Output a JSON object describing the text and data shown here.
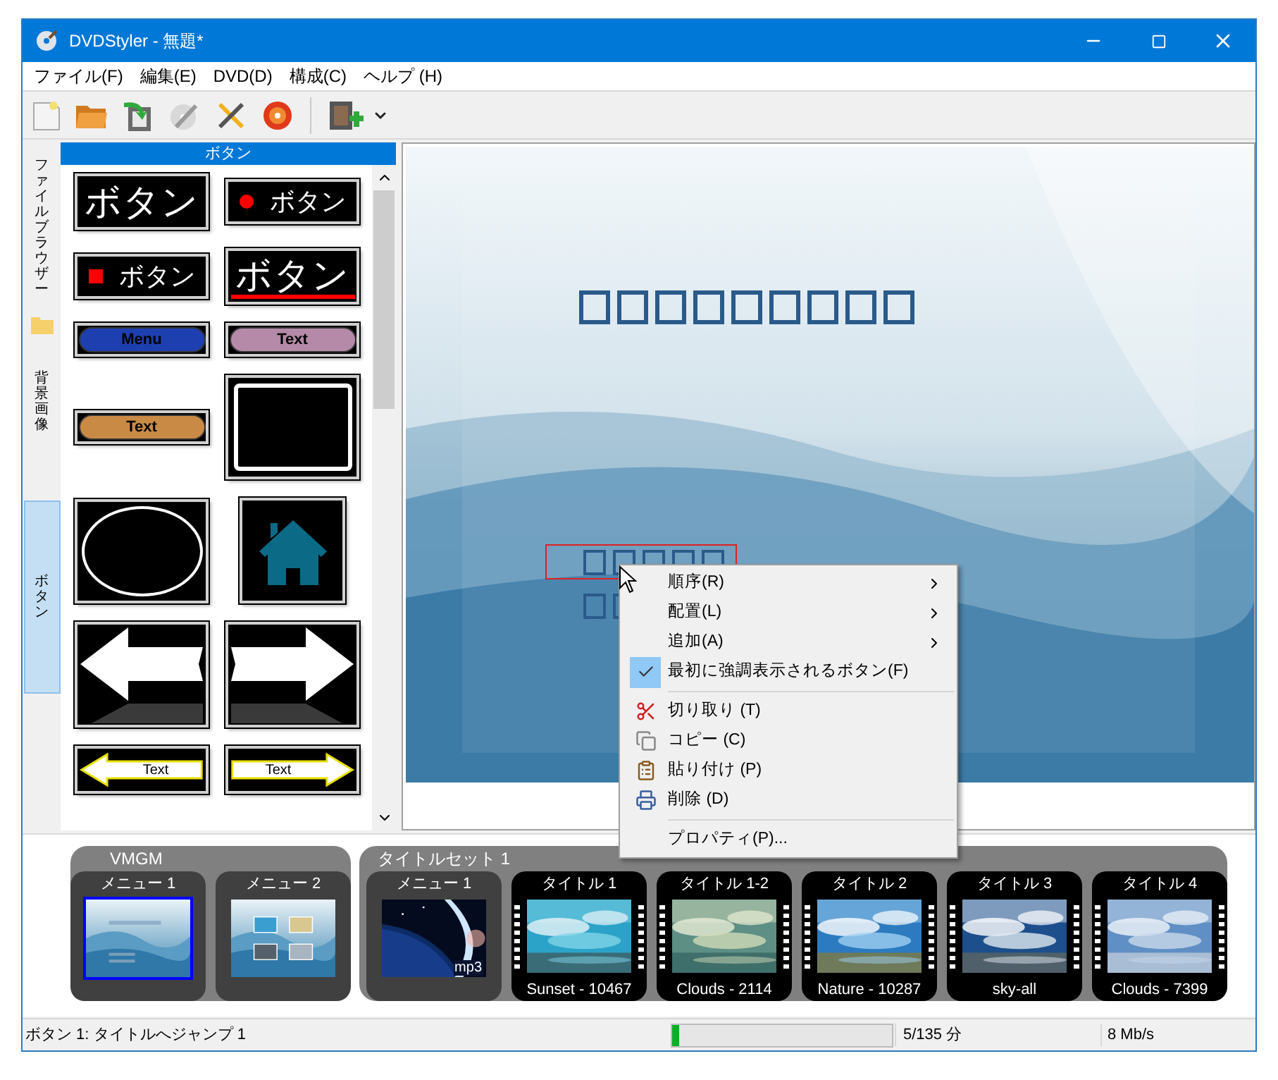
{
  "window": {
    "title": "DVDStyler - 無題*"
  },
  "menu_bar": [
    "ファイル(F)",
    "編集(E)",
    "DVD(D)",
    "構成(C)",
    "ヘルプ (H)"
  ],
  "side_tabs": [
    {
      "label": "ファイルブラウザー",
      "kind": "browser",
      "selected": false
    },
    {
      "label": "背景画像",
      "kind": "plain",
      "selected": false
    },
    {
      "label": "ボタン",
      "kind": "plain",
      "selected": true
    }
  ],
  "panel": {
    "title": "ボタン",
    "templates": [
      {
        "kind": "text",
        "label": "ボタン"
      },
      {
        "kind": "dot",
        "label": "ボタン"
      },
      {
        "kind": "square",
        "label": "ボタン"
      },
      {
        "kind": "underline",
        "label": "ボタン"
      },
      {
        "kind": "pill",
        "label": "Menu",
        "color": "#1d3fb0"
      },
      {
        "kind": "pill",
        "label": "Text",
        "color": "#b48aa8"
      },
      {
        "kind": "pill",
        "label": "Text",
        "color": "#c98a46"
      },
      {
        "kind": "frame-rect"
      },
      {
        "kind": "frame-ellipse"
      },
      {
        "kind": "house"
      },
      {
        "kind": "arrow-left"
      },
      {
        "kind": "arrow-right"
      },
      {
        "kind": "arrow-left",
        "label": "Text"
      },
      {
        "kind": "arrow-right",
        "label": "Text"
      }
    ]
  },
  "context_menu": [
    {
      "kind": "submenu",
      "label": "順序(R)"
    },
    {
      "kind": "submenu",
      "label": "配置(L)"
    },
    {
      "kind": "submenu",
      "label": "追加(A)"
    },
    {
      "kind": "toggle",
      "label": "最初に強調表示されるボタン(F)",
      "checked": true
    },
    {
      "kind": "separator"
    },
    {
      "kind": "cut",
      "label": "切り取り (T)"
    },
    {
      "kind": "copy",
      "label": "コピー (C)"
    },
    {
      "kind": "paste",
      "label": "貼り付け (P)"
    },
    {
      "kind": "delete",
      "label": "削除 (D)"
    },
    {
      "kind": "separator"
    },
    {
      "kind": "plain",
      "label": "プロパティ(P)..."
    }
  ],
  "thumbnails": [
    {
      "label": "VMGM",
      "items": [
        {
          "kind": "menu",
          "label": "メニュー 1",
          "selected": true
        },
        {
          "kind": "menu",
          "label": "メニュー 2",
          "selected": false
        }
      ]
    },
    {
      "label": "タイトルセット 1",
      "items": [
        {
          "kind": "menu",
          "label": "メニュー 1",
          "badge": "mp3",
          "selected": false
        },
        {
          "kind": "title",
          "label": "タイトル 1",
          "caption": "Sunset - 10467",
          "selected": false
        },
        {
          "kind": "title",
          "label": "タイトル 1-2",
          "caption": "Clouds - 2114",
          "selected": false
        },
        {
          "kind": "title",
          "label": "タイトル 2",
          "caption": "Nature - 10287",
          "selected": false
        },
        {
          "kind": "title",
          "label": "タイトル 3",
          "caption": "sky-all",
          "selected": false
        },
        {
          "kind": "title",
          "label": "タイトル 4",
          "caption": "Clouds - 7399",
          "selected": false
        }
      ]
    }
  ],
  "status_bar": {
    "text": "ボタン 1: タイトルへジャンプ 1",
    "progress": {
      "level": 0.035
    },
    "duration": "5/135 分",
    "bitrate": "8 Mb/s"
  }
}
